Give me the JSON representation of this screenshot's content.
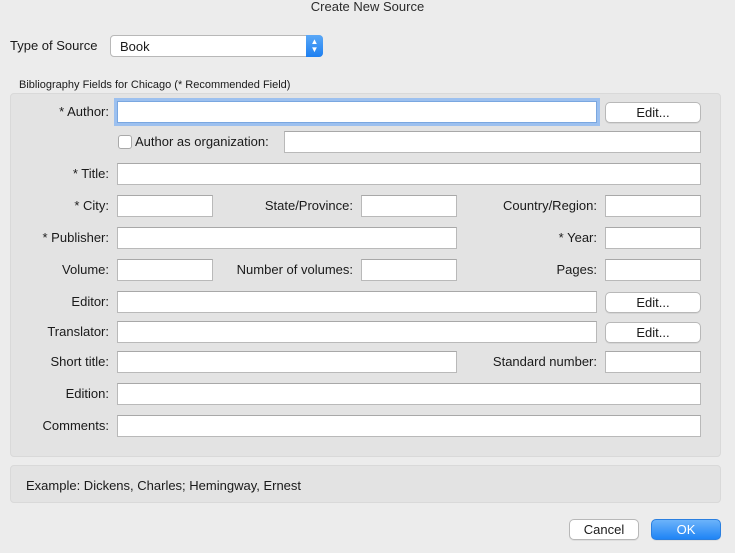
{
  "window": {
    "title": "Create New Source"
  },
  "source_type": {
    "label": "Type of Source",
    "value": "Book"
  },
  "bibliography": {
    "heading": "Bibliography Fields for Chicago  (* Recommended Field)"
  },
  "fields": {
    "author": {
      "label": "* Author:",
      "value": ""
    },
    "author_org": {
      "label": "Author as organization:",
      "value": "",
      "checked": false
    },
    "title": {
      "label": "* Title:",
      "value": ""
    },
    "city": {
      "label": "* City:",
      "value": ""
    },
    "state": {
      "label": "State/Province:",
      "value": ""
    },
    "country": {
      "label": "Country/Region:",
      "value": ""
    },
    "publisher": {
      "label": "* Publisher:",
      "value": ""
    },
    "year": {
      "label": "* Year:",
      "value": ""
    },
    "volume": {
      "label": "Volume:",
      "value": ""
    },
    "num_volumes": {
      "label": "Number of volumes:",
      "value": ""
    },
    "pages": {
      "label": "Pages:",
      "value": ""
    },
    "editor": {
      "label": "Editor:",
      "value": ""
    },
    "translator": {
      "label": "Translator:",
      "value": ""
    },
    "short_title": {
      "label": "Short title:",
      "value": ""
    },
    "standard_number": {
      "label": "Standard number:",
      "value": ""
    },
    "edition": {
      "label": "Edition:",
      "value": ""
    },
    "comments": {
      "label": "Comments:",
      "value": ""
    }
  },
  "buttons": {
    "edit_author": "Edit...",
    "edit_editor": "Edit...",
    "edit_translator": "Edit...",
    "cancel": "Cancel",
    "ok": "OK"
  },
  "example": {
    "text": "Example: Dickens, Charles; Hemingway, Ernest"
  },
  "icons": {
    "stepper": "up-down-chevron-icon"
  },
  "colors": {
    "accent": "#1f84f5",
    "focus_ring": "#9cc0ef"
  }
}
